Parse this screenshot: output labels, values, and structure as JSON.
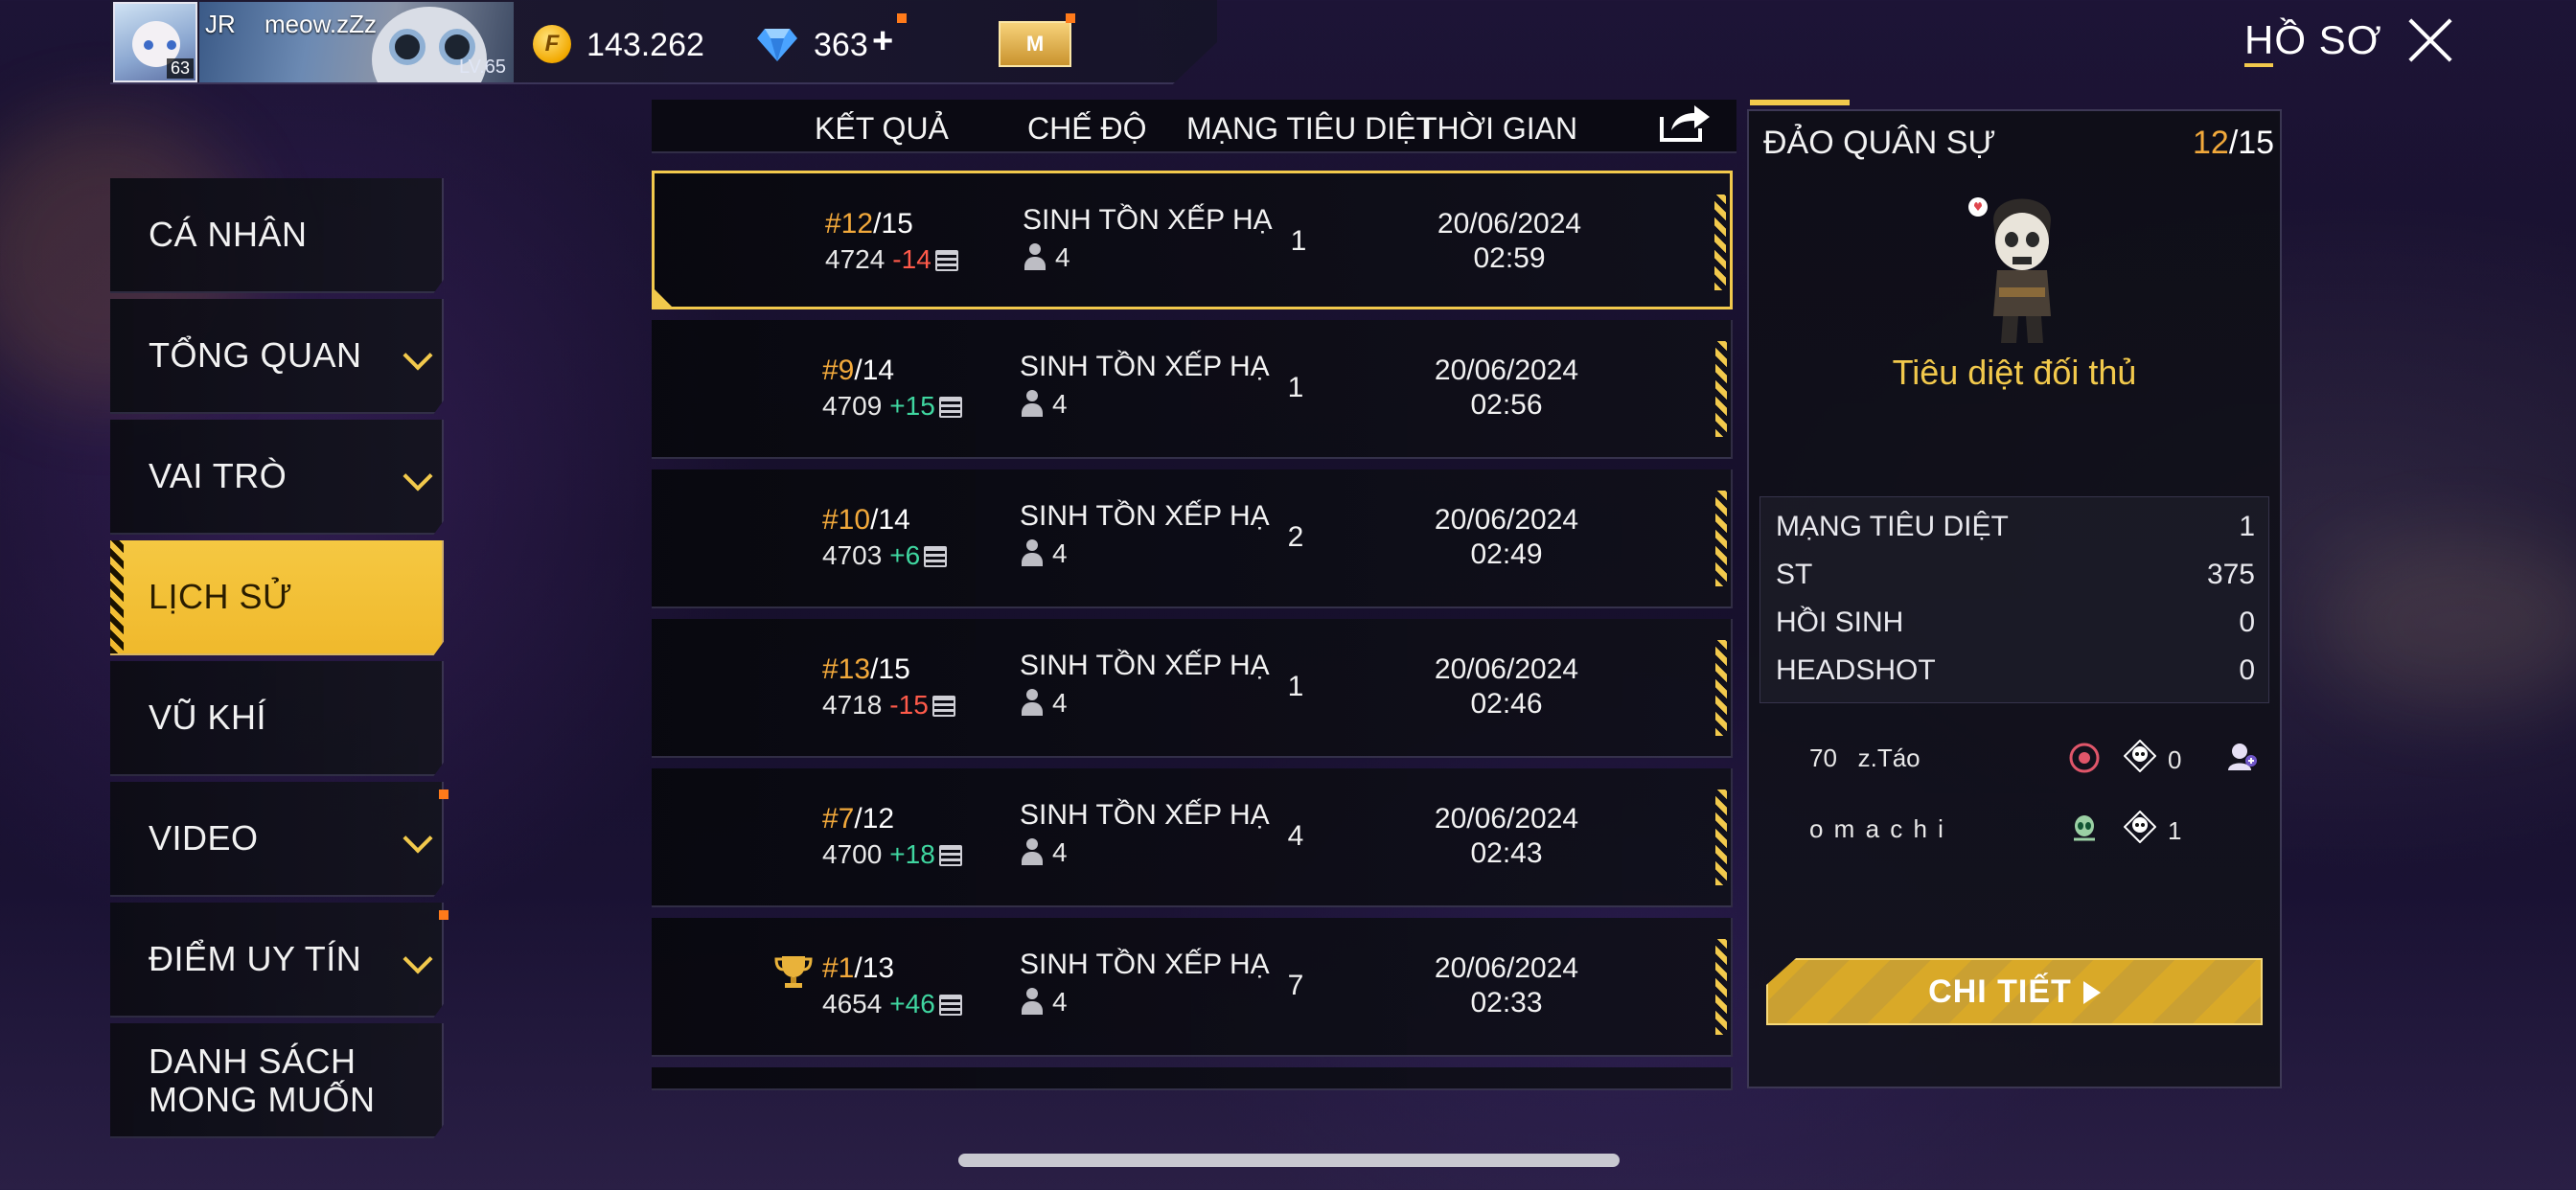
{
  "header": {
    "avatar_level": "63",
    "guild_tag": "JR",
    "player_name": "meow.zZz",
    "player_level": "LV.65",
    "coins": "143.262",
    "diamonds": "363",
    "diamond_plus": "+",
    "membership_label": "M",
    "page_title": "HỒ SƠ"
  },
  "sidebar": {
    "items": [
      {
        "label": "CÁ NHÂN",
        "has_chevron": false
      },
      {
        "label": "TỔNG QUAN",
        "has_chevron": true
      },
      {
        "label": "VAI TRÒ",
        "has_chevron": true
      },
      {
        "label": "LỊCH SỬ",
        "has_chevron": false,
        "active": true
      },
      {
        "label": "VŨ KHÍ",
        "has_chevron": false
      },
      {
        "label": "VIDEO",
        "has_chevron": true
      },
      {
        "label": "ĐIỂM UY TÍN",
        "has_chevron": true
      },
      {
        "label_line1": "DANH SÁCH",
        "label_line2": "MONG MUỐN",
        "has_chevron": false
      }
    ]
  },
  "list": {
    "columns": [
      "KẾT QUẢ",
      "CHẾ ĐỘ",
      "MẠNG TIÊU DIỆT",
      "THỜI GIAN"
    ],
    "rows": [
      {
        "rank": "#12",
        "total": "/15",
        "score": "4724",
        "delta": "-14",
        "mode": "SINH TỒN XẾP HẠ",
        "squad": "4",
        "kills": "1",
        "date": "20/06/2024",
        "time": "02:59"
      },
      {
        "rank": "#9",
        "total": "/14",
        "score": "4709",
        "delta": "+15",
        "mode": "SINH TỒN XẾP HẠ",
        "squad": "4",
        "kills": "1",
        "date": "20/06/2024",
        "time": "02:56"
      },
      {
        "rank": "#10",
        "total": "/14",
        "score": "4703",
        "delta": "+6",
        "mode": "SINH TỒN XẾP HẠ",
        "squad": "4",
        "kills": "2",
        "date": "20/06/2024",
        "time": "02:49"
      },
      {
        "rank": "#13",
        "total": "/15",
        "score": "4718",
        "delta": "-15",
        "mode": "SINH TỒN XẾP HẠ",
        "squad": "4",
        "kills": "1",
        "date": "20/06/2024",
        "time": "02:46"
      },
      {
        "rank": "#7",
        "total": "/12",
        "score": "4700",
        "delta": "+18",
        "mode": "SINH TỒN XẾP HẠ",
        "squad": "4",
        "kills": "4",
        "date": "20/06/2024",
        "time": "02:43"
      },
      {
        "rank": "#1",
        "total": "/13",
        "score": "4654",
        "delta": "+46",
        "mode": "SINH TỒN XẾP HẠ",
        "squad": "4",
        "kills": "7",
        "date": "20/06/2024",
        "time": "02:33"
      }
    ]
  },
  "panel": {
    "map_name": "ĐẢO QUÂN SỰ",
    "placement": "12",
    "placement_total": "/15",
    "subtitle": "Tiêu diệt đối thủ",
    "stats": [
      {
        "label": "MẠNG TIÊU DIỆT",
        "value": "1"
      },
      {
        "label": "ST",
        "value": "375"
      },
      {
        "label": "HỒI SINH",
        "value": "0"
      },
      {
        "label": "HEADSHOT",
        "value": "0"
      }
    ],
    "team": [
      {
        "level": "70",
        "name": "z.Táo",
        "kills": "0"
      },
      {
        "level": "",
        "name": "o m a c h i",
        "kills": "1"
      }
    ],
    "detail_button": "CHI TIẾT"
  },
  "colors": {
    "accent": "#f2c94c",
    "negative": "#ff5a4a",
    "positive": "#3fd6a0",
    "rank_highlight": "#f2a93b"
  }
}
